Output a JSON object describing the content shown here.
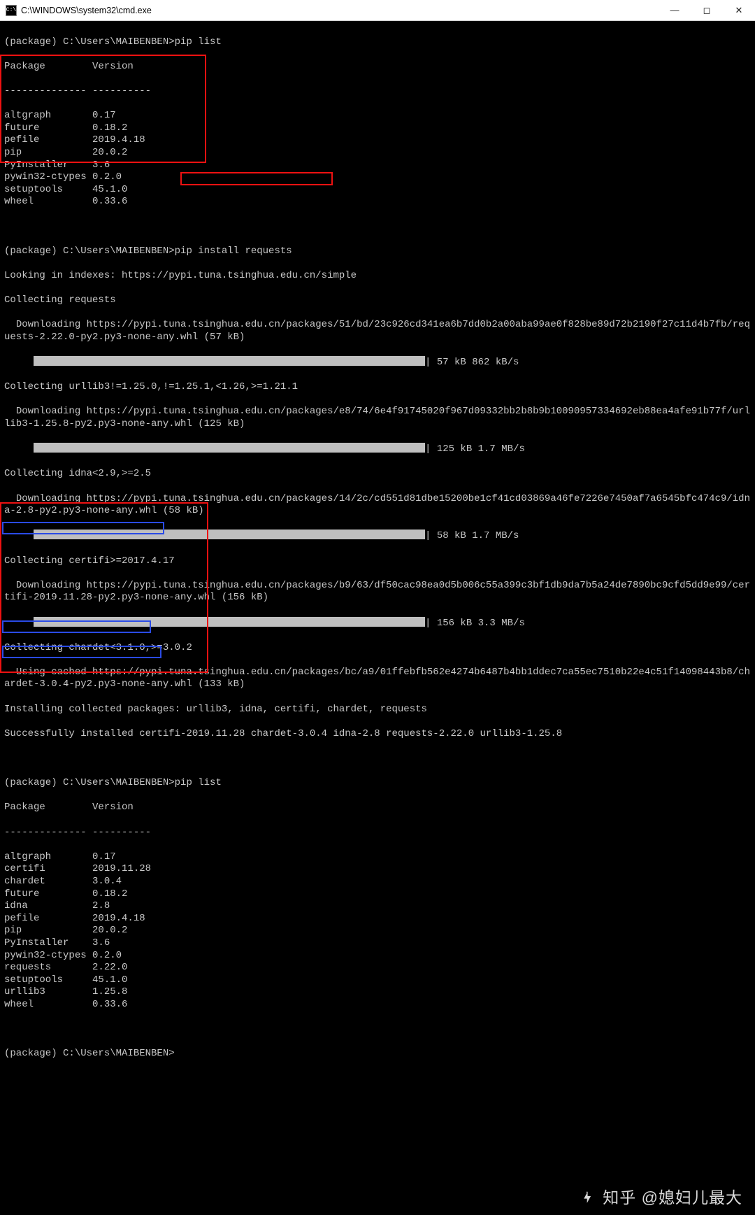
{
  "titlebar": {
    "icon_text": "C:\\",
    "title": "C:\\WINDOWS\\system32\\cmd.exe"
  },
  "prompts": {
    "p1": "(package) C:\\Users\\MAIBENBEN>pip list",
    "p2": "(package) C:\\Users\\MAIBENBEN>pip install requests",
    "p3": "(package) C:\\Users\\MAIBENBEN>pip list",
    "p4": "(package) C:\\Users\\MAIBENBEN>"
  },
  "headers": {
    "pkg": "Package",
    "ver": "Version",
    "sep": "-------------- ----------"
  },
  "list1": [
    {
      "name": "altgraph",
      "ver": "0.17"
    },
    {
      "name": "future",
      "ver": "0.18.2"
    },
    {
      "name": "pefile",
      "ver": "2019.4.18"
    },
    {
      "name": "pip",
      "ver": "20.0.2"
    },
    {
      "name": "PyInstaller",
      "ver": "3.6"
    },
    {
      "name": "pywin32-ctypes",
      "ver": "0.2.0"
    },
    {
      "name": "setuptools",
      "ver": "45.1.0"
    },
    {
      "name": "wheel",
      "ver": "0.33.6"
    }
  ],
  "install": {
    "looking": "Looking in indexes: https://pypi.tuna.tsinghua.edu.cn/simple",
    "c_req": "Collecting requests",
    "d_req": "  Downloading https://pypi.tuna.tsinghua.edu.cn/packages/51/bd/23c926cd341ea6b7dd0b2a00aba99ae0f828be89d72b2190f27c11d4b7fb/requests-2.22.0-py2.py3-none-any.whl (57 kB)",
    "bar1": "| 57 kB 862 kB/s",
    "c_url": "Collecting urllib3!=1.25.0,!=1.25.1,<1.26,>=1.21.1",
    "d_url": "  Downloading https://pypi.tuna.tsinghua.edu.cn/packages/e8/74/6e4f91745020f967d09332bb2b8b9b10090957334692eb88ea4afe91b77f/urllib3-1.25.8-py2.py3-none-any.whl (125 kB)",
    "bar2": "| 125 kB 1.7 MB/s",
    "c_idn": "Collecting idna<2.9,>=2.5",
    "d_idn": "  Downloading https://pypi.tuna.tsinghua.edu.cn/packages/14/2c/cd551d81dbe15200be1cf41cd03869a46fe7226e7450af7a6545bfc474c9/idna-2.8-py2.py3-none-any.whl (58 kB)",
    "bar3": "| 58 kB 1.7 MB/s",
    "c_cer": "Collecting certifi>=2017.4.17",
    "d_cer": "  Downloading https://pypi.tuna.tsinghua.edu.cn/packages/b9/63/df50cac98ea0d5b006c55a399c3bf1db9da7b5a24de7890bc9cfd5dd9e99/certifi-2019.11.28-py2.py3-none-any.whl (156 kB)",
    "bar4": "| 156 kB 3.3 MB/s",
    "c_cha": "Collecting chardet<3.1.0,>=3.0.2",
    "d_cha": "  Using cached https://pypi.tuna.tsinghua.edu.cn/packages/bc/a9/01ffebfb562e4274b6487b4bb1ddec7ca55ec7510b22e4c51f14098443b8/chardet-3.0.4-py2.py3-none-any.whl (133 kB)",
    "installing": "Installing collected packages: urllib3, idna, certifi, chardet, requests",
    "success": "Successfully installed certifi-2019.11.28 chardet-3.0.4 idna-2.8 requests-2.22.0 urllib3-1.25.8"
  },
  "list2": [
    {
      "name": "altgraph",
      "ver": "0.17"
    },
    {
      "name": "certifi",
      "ver": "2019.11.28"
    },
    {
      "name": "chardet",
      "ver": "3.0.4"
    },
    {
      "name": "future",
      "ver": "0.18.2"
    },
    {
      "name": "idna",
      "ver": "2.8"
    },
    {
      "name": "pefile",
      "ver": "2019.4.18"
    },
    {
      "name": "pip",
      "ver": "20.0.2"
    },
    {
      "name": "PyInstaller",
      "ver": "3.6"
    },
    {
      "name": "pywin32-ctypes",
      "ver": "0.2.0"
    },
    {
      "name": "requests",
      "ver": "2.22.0"
    },
    {
      "name": "setuptools",
      "ver": "45.1.0"
    },
    {
      "name": "urllib3",
      "ver": "1.25.8"
    },
    {
      "name": "wheel",
      "ver": "0.33.6"
    }
  ],
  "watermark": "知乎 @媳妇儿最大"
}
